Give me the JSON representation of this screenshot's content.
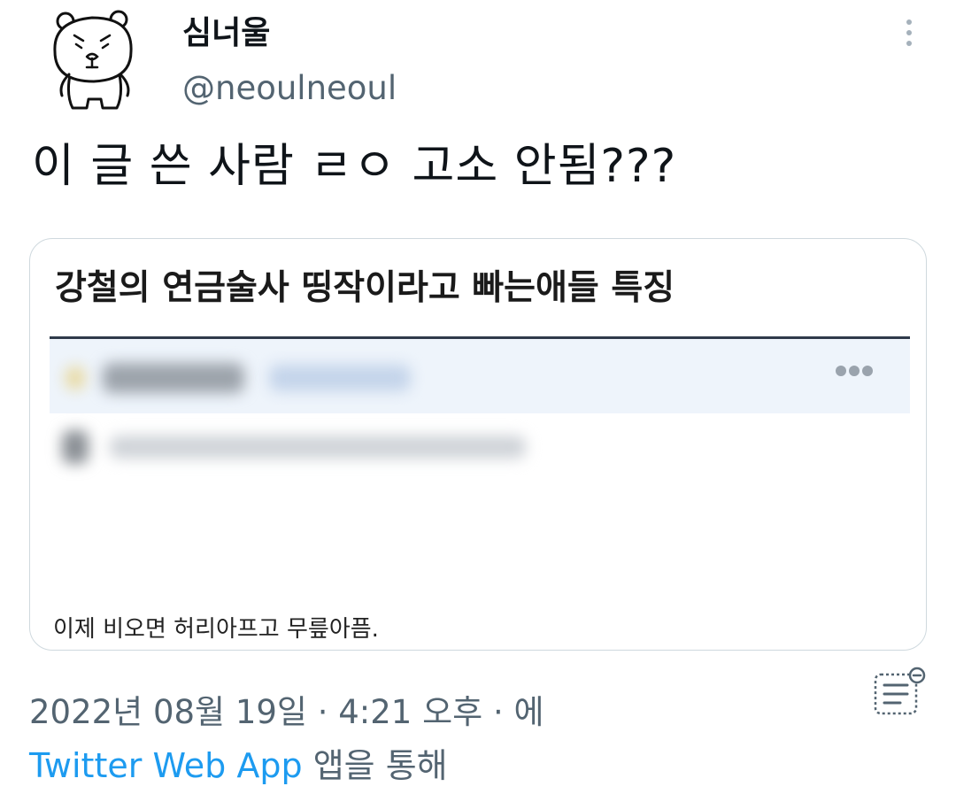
{
  "user": {
    "display_name": "심너울",
    "handle": "@neoulneoul",
    "avatar_icon": "bear-avatar-icon"
  },
  "tweet": {
    "text": "이 글 쓴 사람 ㄹㅇ 고소 안됨???"
  },
  "quoted_card": {
    "title": "강철의 연금술사 띵작이라고 빠는애들 특징",
    "caption": "이제 비오면 허리아프고 무릎아픔.",
    "more_icon": "ellipsis-icon",
    "accent_color": "#2f3a4a"
  },
  "meta": {
    "timestamp": "2022년 08월 19일 · 4:21 오후 · 에",
    "source_app": "Twitter Web App",
    "source_suffix": " 앱을 통해"
  },
  "icons": {
    "more": "more-vertical-icon",
    "analytics": "view-analytics-icon"
  },
  "colors": {
    "link": "#1d9bf0",
    "secondary_text": "#536471",
    "border": "#cfd9de"
  }
}
